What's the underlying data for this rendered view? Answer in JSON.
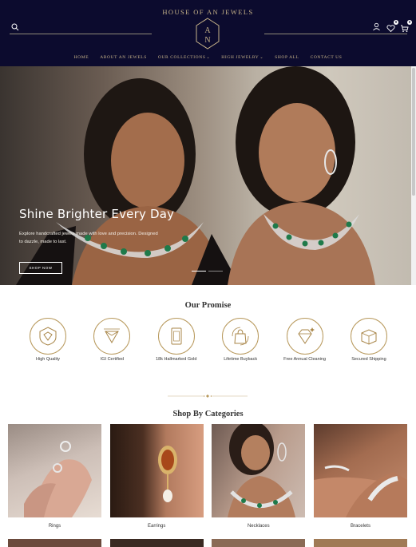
{
  "header": {
    "brand": "HOUSE OF AN JEWELS",
    "logo_letters": "AN",
    "search_placeholder": "",
    "wishlist_count": "0",
    "cart_count": "0",
    "colors": {
      "background": "#0c0b2e",
      "gold": "#c9b58a"
    }
  },
  "nav": {
    "items": [
      {
        "label": "HOME"
      },
      {
        "label": "ABOUT AN JEWELS"
      },
      {
        "label": "OUR COLLECTIONS",
        "dropdown": true
      },
      {
        "label": "HIGH JEWELRY",
        "dropdown": true
      },
      {
        "label": "SHOP ALL"
      },
      {
        "label": "CONTACT US"
      }
    ]
  },
  "hero": {
    "title": "Shine Brighter Every Day",
    "subtitle": "Explore handcrafted jewels made with love and precision. Designed to dazzle, made to last.",
    "button_label": "SHOP NOW",
    "slides": 2,
    "active_slide": 0
  },
  "promise": {
    "title": "Our Promise",
    "items": [
      {
        "label": "High Quality",
        "icon": "gem-shield-icon"
      },
      {
        "label": "IGI Certified",
        "icon": "certified-diamond-icon"
      },
      {
        "label": "18k Hallmarked Gold",
        "icon": "gold-bar-icon"
      },
      {
        "label": "Lifetime Buyback",
        "icon": "buyback-bag-icon"
      },
      {
        "label": "Free Annual Cleaning",
        "icon": "sparkle-diamond-icon"
      },
      {
        "label": "Secured Shipping",
        "icon": "shipping-box-icon"
      }
    ]
  },
  "categories": {
    "title": "Shop By Categories",
    "items": [
      {
        "label": "Rings"
      },
      {
        "label": "Earrings"
      },
      {
        "label": "Necklaces"
      },
      {
        "label": "Bracelets"
      }
    ]
  }
}
